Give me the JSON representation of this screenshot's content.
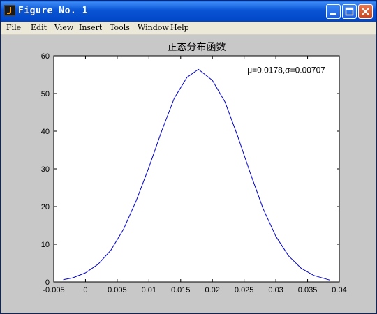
{
  "window": {
    "title": "Figure No. 1",
    "icons": {
      "app": "matlab-figure-icon",
      "minimize": "minimize-icon",
      "maximize": "maximize-icon",
      "close": "close-icon"
    }
  },
  "menubar": {
    "items": [
      {
        "label": "File"
      },
      {
        "label": "Edit"
      },
      {
        "label": "View"
      },
      {
        "label": "Insert"
      },
      {
        "label": "Tools"
      },
      {
        "label": "Window"
      },
      {
        "label": "Help"
      }
    ]
  },
  "chart_data": {
    "type": "line",
    "title": "正态分布函数",
    "annotation": "μ=0.0178,σ=0.00707",
    "xlabel": "",
    "ylabel": "",
    "xlim": [
      -0.005,
      0.04
    ],
    "ylim": [
      0,
      60
    ],
    "xticks": [
      "-0.005",
      "0",
      "0.005",
      "0.01",
      "0.015",
      "0.02",
      "0.025",
      "0.03",
      "0.035",
      "0.04"
    ],
    "yticks": [
      "0",
      "10",
      "20",
      "30",
      "40",
      "50",
      "60"
    ],
    "grid": false,
    "series": [
      {
        "color": "#0000c8",
        "mu": 0.0178,
        "sigma": 0.00707,
        "x": [
          -0.0035,
          -0.002,
          0.0,
          0.002,
          0.004,
          0.006,
          0.008,
          0.01,
          0.012,
          0.014,
          0.016,
          0.0178,
          0.02,
          0.022,
          0.024,
          0.026,
          0.028,
          0.03,
          0.032,
          0.034,
          0.036,
          0.0385
        ],
        "y": [
          0.6,
          1.1,
          2.4,
          4.7,
          8.4,
          14.0,
          21.6,
          30.4,
          40.0,
          48.8,
          54.3,
          56.4,
          53.5,
          47.7,
          38.6,
          28.7,
          19.4,
          12.1,
          6.9,
          3.6,
          1.7,
          0.5
        ]
      }
    ]
  }
}
